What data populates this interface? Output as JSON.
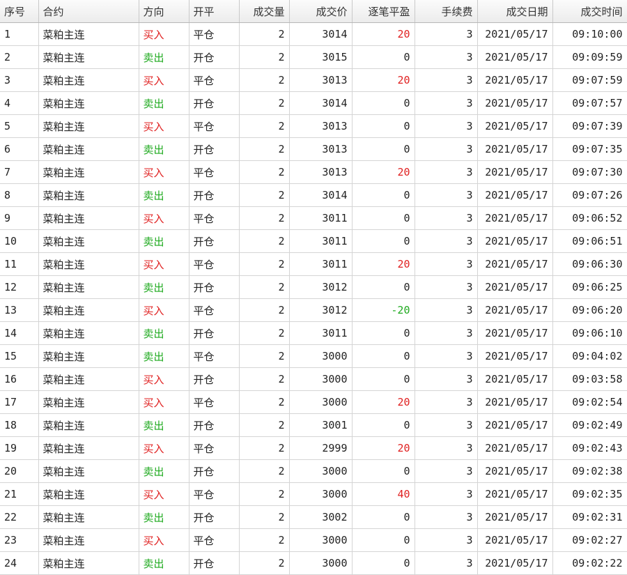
{
  "columns": [
    "序号",
    "合约",
    "方向",
    "开平",
    "成交量",
    "成交价",
    "逐笔平盈",
    "手续费",
    "成交日期",
    "成交时间"
  ],
  "rows": [
    {
      "idx": "1",
      "contract": "菜粕主连",
      "dir": "买入",
      "oc": "平仓",
      "qty": "2",
      "price": "3014",
      "pnl": "20",
      "fee": "3",
      "date": "2021/05/17",
      "time": "09:10:00"
    },
    {
      "idx": "2",
      "contract": "菜粕主连",
      "dir": "卖出",
      "oc": "开仓",
      "qty": "2",
      "price": "3015",
      "pnl": "0",
      "fee": "3",
      "date": "2021/05/17",
      "time": "09:09:59"
    },
    {
      "idx": "3",
      "contract": "菜粕主连",
      "dir": "买入",
      "oc": "平仓",
      "qty": "2",
      "price": "3013",
      "pnl": "20",
      "fee": "3",
      "date": "2021/05/17",
      "time": "09:07:59"
    },
    {
      "idx": "4",
      "contract": "菜粕主连",
      "dir": "卖出",
      "oc": "开仓",
      "qty": "2",
      "price": "3014",
      "pnl": "0",
      "fee": "3",
      "date": "2021/05/17",
      "time": "09:07:57"
    },
    {
      "idx": "5",
      "contract": "菜粕主连",
      "dir": "买入",
      "oc": "平仓",
      "qty": "2",
      "price": "3013",
      "pnl": "0",
      "fee": "3",
      "date": "2021/05/17",
      "time": "09:07:39"
    },
    {
      "idx": "6",
      "contract": "菜粕主连",
      "dir": "卖出",
      "oc": "开仓",
      "qty": "2",
      "price": "3013",
      "pnl": "0",
      "fee": "3",
      "date": "2021/05/17",
      "time": "09:07:35"
    },
    {
      "idx": "7",
      "contract": "菜粕主连",
      "dir": "买入",
      "oc": "平仓",
      "qty": "2",
      "price": "3013",
      "pnl": "20",
      "fee": "3",
      "date": "2021/05/17",
      "time": "09:07:30"
    },
    {
      "idx": "8",
      "contract": "菜粕主连",
      "dir": "卖出",
      "oc": "开仓",
      "qty": "2",
      "price": "3014",
      "pnl": "0",
      "fee": "3",
      "date": "2021/05/17",
      "time": "09:07:26"
    },
    {
      "idx": "9",
      "contract": "菜粕主连",
      "dir": "买入",
      "oc": "平仓",
      "qty": "2",
      "price": "3011",
      "pnl": "0",
      "fee": "3",
      "date": "2021/05/17",
      "time": "09:06:52"
    },
    {
      "idx": "10",
      "contract": "菜粕主连",
      "dir": "卖出",
      "oc": "开仓",
      "qty": "2",
      "price": "3011",
      "pnl": "0",
      "fee": "3",
      "date": "2021/05/17",
      "time": "09:06:51"
    },
    {
      "idx": "11",
      "contract": "菜粕主连",
      "dir": "买入",
      "oc": "平仓",
      "qty": "2",
      "price": "3011",
      "pnl": "20",
      "fee": "3",
      "date": "2021/05/17",
      "time": "09:06:30"
    },
    {
      "idx": "12",
      "contract": "菜粕主连",
      "dir": "卖出",
      "oc": "开仓",
      "qty": "2",
      "price": "3012",
      "pnl": "0",
      "fee": "3",
      "date": "2021/05/17",
      "time": "09:06:25"
    },
    {
      "idx": "13",
      "contract": "菜粕主连",
      "dir": "买入",
      "oc": "平仓",
      "qty": "2",
      "price": "3012",
      "pnl": "-20",
      "fee": "3",
      "date": "2021/05/17",
      "time": "09:06:20"
    },
    {
      "idx": "14",
      "contract": "菜粕主连",
      "dir": "卖出",
      "oc": "开仓",
      "qty": "2",
      "price": "3011",
      "pnl": "0",
      "fee": "3",
      "date": "2021/05/17",
      "time": "09:06:10"
    },
    {
      "idx": "15",
      "contract": "菜粕主连",
      "dir": "卖出",
      "oc": "平仓",
      "qty": "2",
      "price": "3000",
      "pnl": "0",
      "fee": "3",
      "date": "2021/05/17",
      "time": "09:04:02"
    },
    {
      "idx": "16",
      "contract": "菜粕主连",
      "dir": "买入",
      "oc": "开仓",
      "qty": "2",
      "price": "3000",
      "pnl": "0",
      "fee": "3",
      "date": "2021/05/17",
      "time": "09:03:58"
    },
    {
      "idx": "17",
      "contract": "菜粕主连",
      "dir": "买入",
      "oc": "平仓",
      "qty": "2",
      "price": "3000",
      "pnl": "20",
      "fee": "3",
      "date": "2021/05/17",
      "time": "09:02:54"
    },
    {
      "idx": "18",
      "contract": "菜粕主连",
      "dir": "卖出",
      "oc": "开仓",
      "qty": "2",
      "price": "3001",
      "pnl": "0",
      "fee": "3",
      "date": "2021/05/17",
      "time": "09:02:49"
    },
    {
      "idx": "19",
      "contract": "菜粕主连",
      "dir": "买入",
      "oc": "平仓",
      "qty": "2",
      "price": "2999",
      "pnl": "20",
      "fee": "3",
      "date": "2021/05/17",
      "time": "09:02:43"
    },
    {
      "idx": "20",
      "contract": "菜粕主连",
      "dir": "卖出",
      "oc": "开仓",
      "qty": "2",
      "price": "3000",
      "pnl": "0",
      "fee": "3",
      "date": "2021/05/17",
      "time": "09:02:38"
    },
    {
      "idx": "21",
      "contract": "菜粕主连",
      "dir": "买入",
      "oc": "平仓",
      "qty": "2",
      "price": "3000",
      "pnl": "40",
      "fee": "3",
      "date": "2021/05/17",
      "time": "09:02:35"
    },
    {
      "idx": "22",
      "contract": "菜粕主连",
      "dir": "卖出",
      "oc": "开仓",
      "qty": "2",
      "price": "3002",
      "pnl": "0",
      "fee": "3",
      "date": "2021/05/17",
      "time": "09:02:31"
    },
    {
      "idx": "23",
      "contract": "菜粕主连",
      "dir": "买入",
      "oc": "平仓",
      "qty": "2",
      "price": "3000",
      "pnl": "0",
      "fee": "3",
      "date": "2021/05/17",
      "time": "09:02:27"
    },
    {
      "idx": "24",
      "contract": "菜粕主连",
      "dir": "卖出",
      "oc": "开仓",
      "qty": "2",
      "price": "3000",
      "pnl": "0",
      "fee": "3",
      "date": "2021/05/17",
      "time": "09:02:22"
    }
  ],
  "colors": {
    "buy": "#e02020",
    "sell": "#1faa1f",
    "profit": "#e02020",
    "loss": "#1faa1f"
  }
}
